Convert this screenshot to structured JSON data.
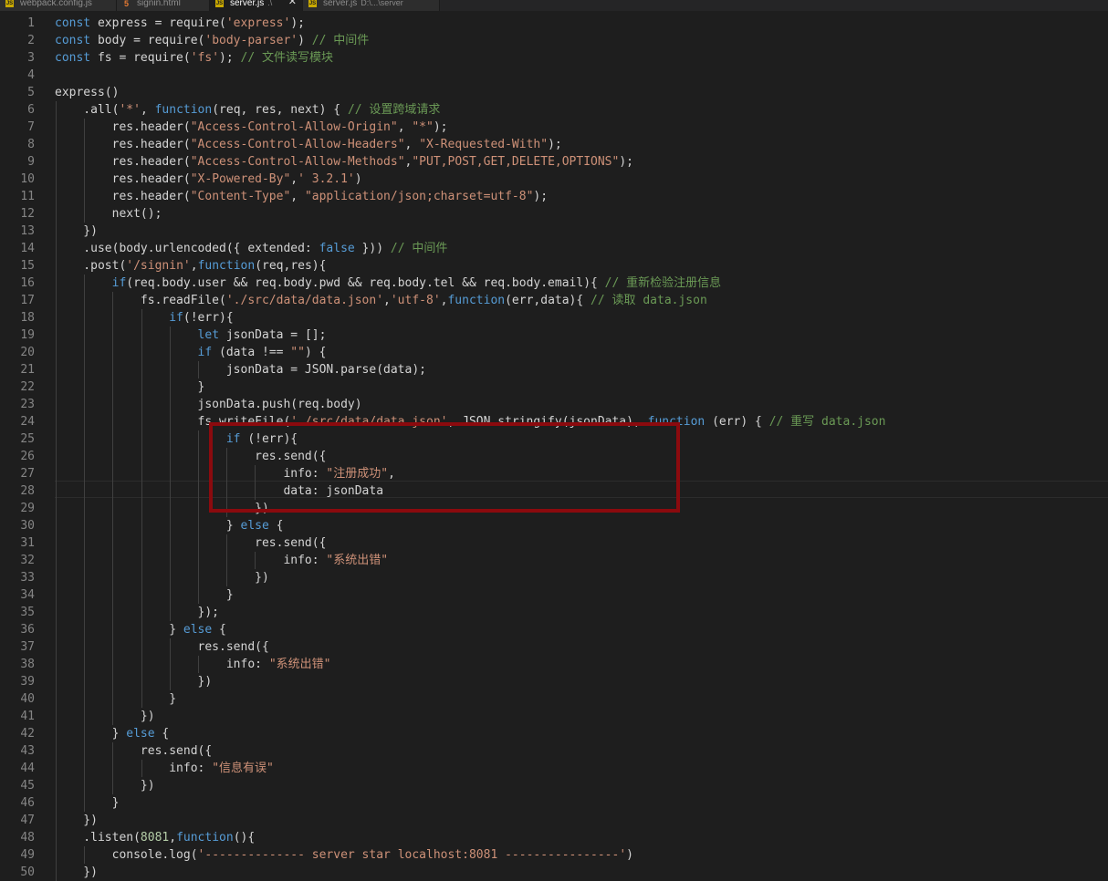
{
  "tabs": [
    {
      "label": "webpack.config.js",
      "path": "",
      "type": "js",
      "active": false
    },
    {
      "label": "signin.html",
      "path": "",
      "type": "html",
      "active": false
    },
    {
      "label": "server.js",
      "path": ".\\",
      "type": "js",
      "active": true,
      "close": "✕"
    },
    {
      "label": "server.js",
      "path": "D:\\...\\server",
      "type": "js",
      "active": false
    }
  ],
  "tab_icons": {
    "js": "JS",
    "html": "5"
  },
  "colors": {
    "keyword": "#569cd6",
    "string": "#ce9178",
    "comment": "#6a9955",
    "number": "#b5cea8",
    "text": "#d4d4d4",
    "highlight_box": "#8b0a0e"
  },
  "highlight": {
    "from_line": 25,
    "to_line": 29
  },
  "lines": [
    [
      [
        "kw",
        "const"
      ],
      [
        "pl",
        " express = require("
      ],
      [
        "str",
        "'express'"
      ],
      [
        "pl",
        ");"
      ]
    ],
    [
      [
        "kw",
        "const"
      ],
      [
        "pl",
        " body = require("
      ],
      [
        "str",
        "'body-parser'"
      ],
      [
        "pl",
        ") "
      ],
      [
        "cm",
        "// 中间件"
      ]
    ],
    [
      [
        "kw",
        "const"
      ],
      [
        "pl",
        " fs = require("
      ],
      [
        "str",
        "'fs'"
      ],
      [
        "pl",
        "); "
      ],
      [
        "cm",
        "// 文件读写模块"
      ]
    ],
    [],
    [
      [
        "pl",
        "express()"
      ]
    ],
    [
      [
        "pl",
        "    .all("
      ],
      [
        "str",
        "'*'"
      ],
      [
        "pl",
        ", "
      ],
      [
        "fn",
        "function"
      ],
      [
        "pl",
        "(req, res, next) { "
      ],
      [
        "cm",
        "// 设置跨域请求"
      ]
    ],
    [
      [
        "pl",
        "        res.header("
      ],
      [
        "str",
        "\"Access-Control-Allow-Origin\""
      ],
      [
        "pl",
        ", "
      ],
      [
        "str",
        "\"*\""
      ],
      [
        "pl",
        ");"
      ]
    ],
    [
      [
        "pl",
        "        res.header("
      ],
      [
        "str",
        "\"Access-Control-Allow-Headers\""
      ],
      [
        "pl",
        ", "
      ],
      [
        "str",
        "\"X-Requested-With\""
      ],
      [
        "pl",
        ");"
      ]
    ],
    [
      [
        "pl",
        "        res.header("
      ],
      [
        "str",
        "\"Access-Control-Allow-Methods\""
      ],
      [
        "pl",
        ","
      ],
      [
        "str",
        "\"PUT,POST,GET,DELETE,OPTIONS\""
      ],
      [
        "pl",
        ");"
      ]
    ],
    [
      [
        "pl",
        "        res.header("
      ],
      [
        "str",
        "\"X-Powered-By\""
      ],
      [
        "pl",
        ","
      ],
      [
        "str",
        "' 3.2.1'"
      ],
      [
        "pl",
        ")"
      ]
    ],
    [
      [
        "pl",
        "        res.header("
      ],
      [
        "str",
        "\"Content-Type\""
      ],
      [
        "pl",
        ", "
      ],
      [
        "str",
        "\"application/json;charset=utf-8\""
      ],
      [
        "pl",
        ");"
      ]
    ],
    [
      [
        "pl",
        "        next();"
      ]
    ],
    [
      [
        "pl",
        "    })"
      ]
    ],
    [
      [
        "pl",
        "    .use(body.urlencoded({ extended: "
      ],
      [
        "kw",
        "false"
      ],
      [
        "pl",
        " })) "
      ],
      [
        "cm",
        "// 中间件"
      ]
    ],
    [
      [
        "pl",
        "    .post("
      ],
      [
        "str",
        "'/signin'"
      ],
      [
        "pl",
        ","
      ],
      [
        "fn",
        "function"
      ],
      [
        "pl",
        "(req,res){"
      ]
    ],
    [
      [
        "pl",
        "        "
      ],
      [
        "kw",
        "if"
      ],
      [
        "pl",
        "(req.body.user && req.body.pwd && req.body.tel && req.body.email){ "
      ],
      [
        "cm",
        "// 重新检验注册信息"
      ]
    ],
    [
      [
        "pl",
        "            fs.readFile("
      ],
      [
        "str",
        "'./src/data/data.json'"
      ],
      [
        "pl",
        ","
      ],
      [
        "str",
        "'utf-8'"
      ],
      [
        "pl",
        ","
      ],
      [
        "fn",
        "function"
      ],
      [
        "pl",
        "(err,data){ "
      ],
      [
        "cm",
        "// 读取 data.json"
      ]
    ],
    [
      [
        "pl",
        "                "
      ],
      [
        "kw",
        "if"
      ],
      [
        "pl",
        "(!err){"
      ]
    ],
    [
      [
        "pl",
        "                    "
      ],
      [
        "kw",
        "let"
      ],
      [
        "pl",
        " jsonData = [];"
      ]
    ],
    [
      [
        "pl",
        "                    "
      ],
      [
        "kw",
        "if"
      ],
      [
        "pl",
        " (data !== "
      ],
      [
        "str",
        "\"\""
      ],
      [
        "pl",
        ") {"
      ]
    ],
    [
      [
        "pl",
        "                        jsonData = JSON.parse(data);"
      ]
    ],
    [
      [
        "pl",
        "                    }"
      ]
    ],
    [
      [
        "pl",
        "                    jsonData.push(req.body)"
      ]
    ],
    [
      [
        "pl",
        "                    fs.writeFile("
      ],
      [
        "str",
        "'./src/data/data.json'"
      ],
      [
        "pl",
        ", JSON.stringify(jsonData), "
      ],
      [
        "fn",
        "function"
      ],
      [
        "pl",
        " (err) { "
      ],
      [
        "cm",
        "// 重写 data.json"
      ]
    ],
    [
      [
        "pl",
        "                        "
      ],
      [
        "kw",
        "if"
      ],
      [
        "pl",
        " (!err){"
      ]
    ],
    [
      [
        "pl",
        "                            res.send({"
      ]
    ],
    [
      [
        "pl",
        "                                info: "
      ],
      [
        "str",
        "\"注册成功\""
      ],
      [
        "pl",
        ","
      ]
    ],
    [
      [
        "pl",
        "                                data: jsonData"
      ]
    ],
    [
      [
        "pl",
        "                            })"
      ]
    ],
    [
      [
        "pl",
        "                        } "
      ],
      [
        "kw",
        "else"
      ],
      [
        "pl",
        " {"
      ]
    ],
    [
      [
        "pl",
        "                            res.send({"
      ]
    ],
    [
      [
        "pl",
        "                                info: "
      ],
      [
        "str",
        "\"系统出错\""
      ]
    ],
    [
      [
        "pl",
        "                            })"
      ]
    ],
    [
      [
        "pl",
        "                        }"
      ]
    ],
    [
      [
        "pl",
        "                    });"
      ]
    ],
    [
      [
        "pl",
        "                } "
      ],
      [
        "kw",
        "else"
      ],
      [
        "pl",
        " {"
      ]
    ],
    [
      [
        "pl",
        "                    res.send({"
      ]
    ],
    [
      [
        "pl",
        "                        info: "
      ],
      [
        "str",
        "\"系统出错\""
      ]
    ],
    [
      [
        "pl",
        "                    })"
      ]
    ],
    [
      [
        "pl",
        "                }"
      ]
    ],
    [
      [
        "pl",
        "            })"
      ]
    ],
    [
      [
        "pl",
        "        } "
      ],
      [
        "kw",
        "else"
      ],
      [
        "pl",
        " {"
      ]
    ],
    [
      [
        "pl",
        "            res.send({"
      ]
    ],
    [
      [
        "pl",
        "                info: "
      ],
      [
        "str",
        "\"信息有误\""
      ]
    ],
    [
      [
        "pl",
        "            })"
      ]
    ],
    [
      [
        "pl",
        "        }"
      ]
    ],
    [
      [
        "pl",
        "    })"
      ]
    ],
    [
      [
        "pl",
        "    .listen("
      ],
      [
        "num",
        "8081"
      ],
      [
        "pl",
        ","
      ],
      [
        "fn",
        "function"
      ],
      [
        "pl",
        "(){"
      ]
    ],
    [
      [
        "pl",
        "        console.log("
      ],
      [
        "str",
        "'-------------- server star localhost:8081 ----------------'"
      ],
      [
        "pl",
        ")"
      ]
    ],
    [
      [
        "pl",
        "    })"
      ]
    ]
  ]
}
